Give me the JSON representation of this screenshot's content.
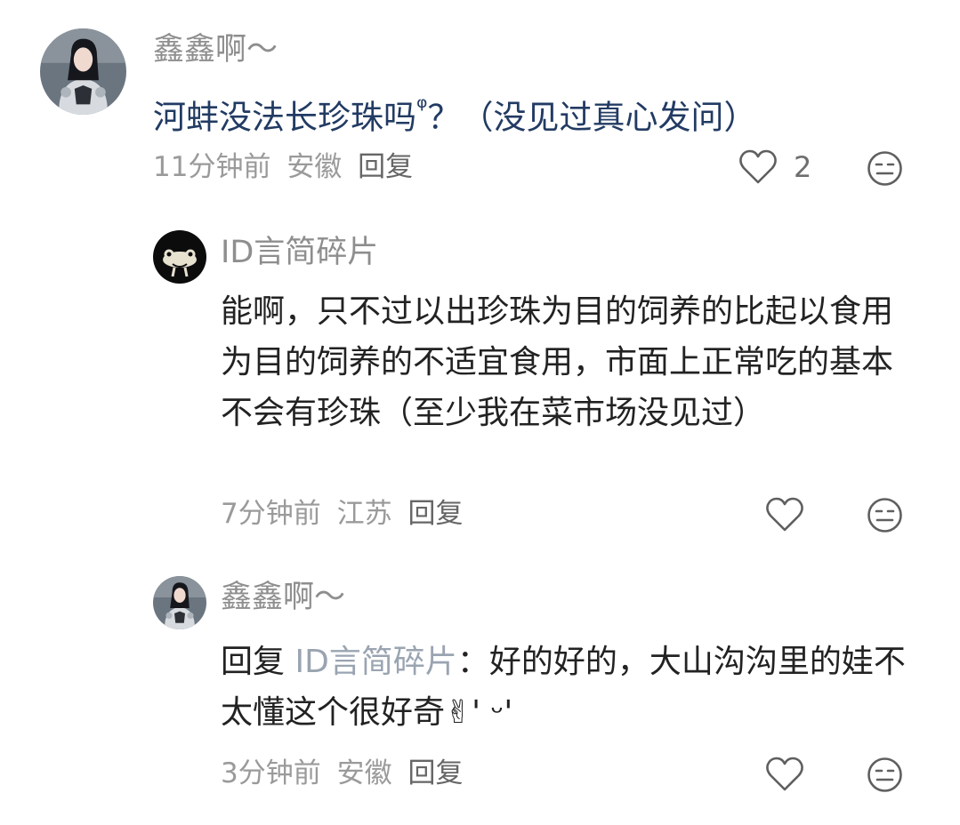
{
  "comments": [
    {
      "username": "鑫鑫啊～",
      "text": "河蚌没法长珍珠吗",
      "text_suffix": "？（没见过真心发问）",
      "search_glyph": "ᵠ",
      "time": "11分钟前",
      "location": "安徽",
      "reply_label": "回复",
      "likes": "2"
    },
    {
      "username": "ID言简碎片",
      "text": "能啊，只不过以出珍珠为目的饲养的比起以食用为目的饲养的不适宜食用，市面上正常吃的基本不会有珍珠（至少我在菜市场没见过）",
      "time": "7分钟前",
      "location": "江苏",
      "reply_label": "回复"
    },
    {
      "username": "鑫鑫啊～",
      "reply_prefix": "回复",
      "mention": "ID言简碎片",
      "colon": "：",
      "text": "好的好的，大山沟沟里的娃不太懂这个很好奇✌' ᵕ'",
      "time": "3分钟前",
      "location": "安徽",
      "reply_label": "回复"
    }
  ]
}
